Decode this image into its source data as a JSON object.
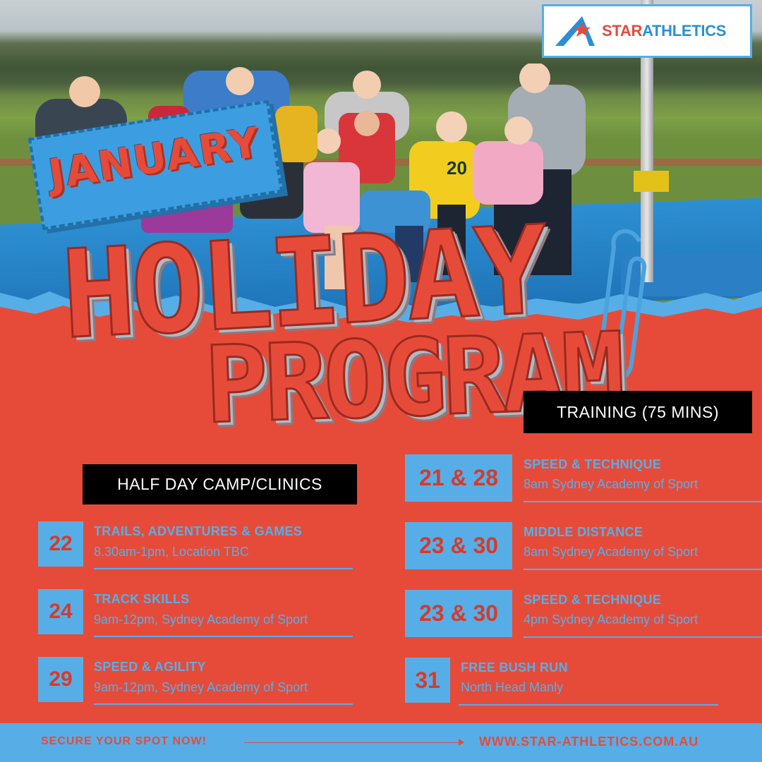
{
  "logo": {
    "brand_first": "STAR",
    "brand_second": "ATHLETICS"
  },
  "headline": {
    "line1": "JANUARY",
    "line2": "HOLIDAY",
    "line3": "PROGRAM"
  },
  "training": {
    "label": "TRAINING (75 MINS)",
    "items": [
      {
        "date": "21 & 28",
        "title": "SPEED & TECHNIQUE",
        "detail": "8am Sydney Academy of Sport"
      },
      {
        "date": "23 & 30",
        "title": "MIDDLE DISTANCE",
        "detail": "8am Sydney Academy of Sport"
      },
      {
        "date": "23 & 30",
        "title": "SPEED & TECHNIQUE",
        "detail": "4pm Sydney Academy of Sport"
      },
      {
        "date": "31",
        "title": "FREE BUSH RUN",
        "detail": "North Head Manly"
      }
    ]
  },
  "camp": {
    "label": "HALF DAY CAMP/CLINICS",
    "items": [
      {
        "date": "22",
        "title": "TRAILS, ADVENTURES & GAMES",
        "detail": "8.30am-1pm, Location TBC"
      },
      {
        "date": "24",
        "title": "TRACK SKILLS",
        "detail": "9am-12pm, Sydney Academy of Sport"
      },
      {
        "date": "29",
        "title": "SPEED & AGILITY",
        "detail": "9am-12pm, Sydney Academy of Sport"
      }
    ]
  },
  "jersey_number": "20",
  "footer": {
    "cta": "SECURE YOUR SPOT NOW!",
    "url": "WWW.STAR-ATHLETICS.COM.AU"
  },
  "colors": {
    "red": "#e64b3a",
    "blue": "#57aee6",
    "black": "#000000"
  }
}
